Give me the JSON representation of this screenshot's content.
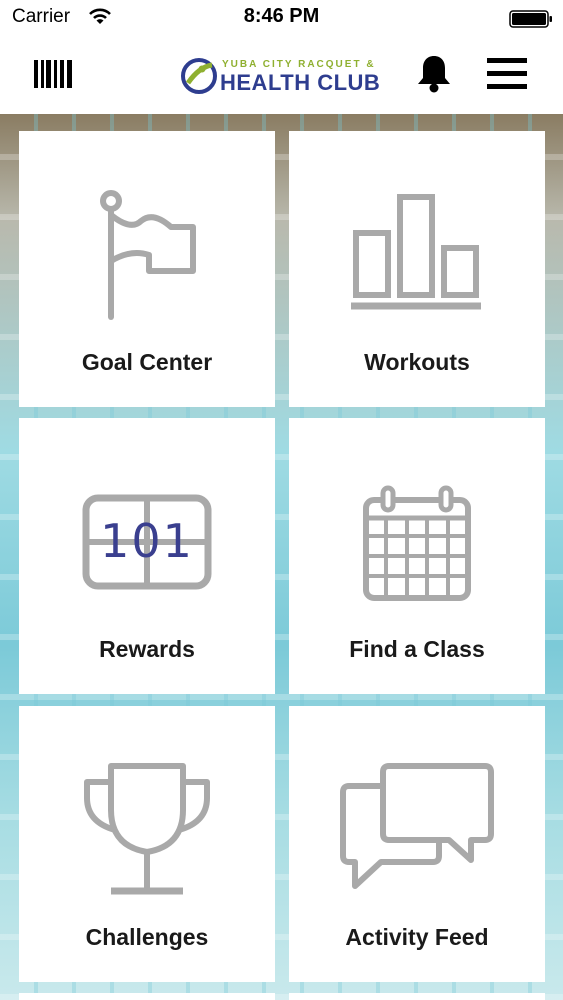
{
  "status_bar": {
    "carrier": "Carrier",
    "time": "8:46 PM"
  },
  "header": {
    "logo_top": "YUBA CITY RACQUET &",
    "logo_main": "HEALTH CLUB",
    "icons": [
      "barcode-icon",
      "bell-icon",
      "hamburger-menu-icon"
    ]
  },
  "colors": {
    "tile_bg": "#ffffff",
    "icon_gray": "#a9a9a9",
    "brand_blue": "#2e3d8f",
    "brand_green": "#8fb030"
  },
  "tiles": [
    {
      "label": "Goal Center",
      "icon": "flag-icon"
    },
    {
      "label": "Workouts",
      "icon": "bar-chart-icon"
    },
    {
      "label": "Rewards",
      "icon": "rewards-card-icon",
      "value": "101"
    },
    {
      "label": "Find a Class",
      "icon": "calendar-icon"
    },
    {
      "label": "Challenges",
      "icon": "trophy-icon"
    },
    {
      "label": "Activity Feed",
      "icon": "chat-bubbles-icon"
    }
  ]
}
